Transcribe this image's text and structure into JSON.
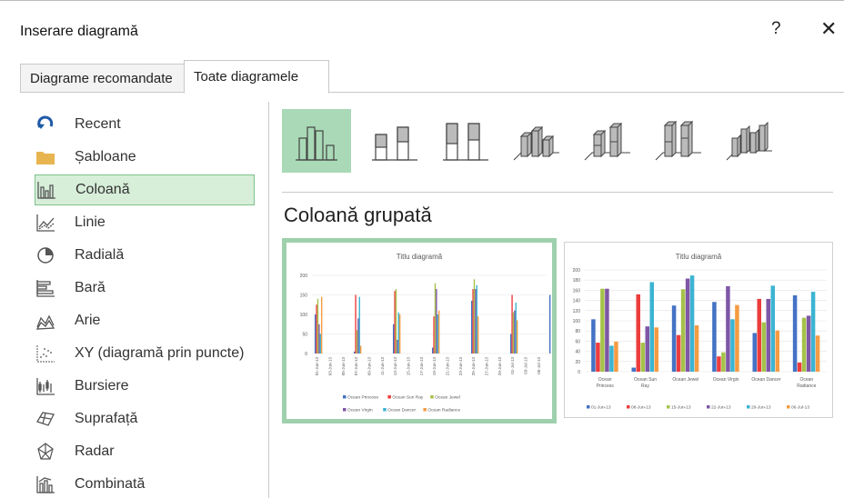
{
  "dialog": {
    "title": "Inserare diagramă",
    "help": "?",
    "close": "✕"
  },
  "tabs": [
    {
      "label": "Diagrame recomandate"
    },
    {
      "label": "Toate diagramele"
    }
  ],
  "categories": [
    {
      "label": "Recent",
      "icon": "recent-icon"
    },
    {
      "label": "Șabloane",
      "icon": "folder-icon"
    },
    {
      "label": "Coloană",
      "icon": "column-chart-icon",
      "selected": true
    },
    {
      "label": "Linie",
      "icon": "line-chart-icon"
    },
    {
      "label": "Radială",
      "icon": "pie-chart-icon"
    },
    {
      "label": "Bară",
      "icon": "bar-chart-icon"
    },
    {
      "label": "Arie",
      "icon": "area-chart-icon"
    },
    {
      "label": "XY (diagramă prin puncte)",
      "icon": "scatter-chart-icon"
    },
    {
      "label": "Bursiere",
      "icon": "stock-chart-icon"
    },
    {
      "label": "Suprafață",
      "icon": "surface-chart-icon"
    },
    {
      "label": "Radar",
      "icon": "radar-chart-icon"
    },
    {
      "label": "Combinată",
      "icon": "combo-chart-icon"
    }
  ],
  "subtype_heading": "Coloană grupată",
  "accent_color": "#a9d9b6",
  "chart_data": [
    {
      "type": "bar",
      "title": "Titlu diagramă",
      "ylim": [
        0,
        200
      ],
      "yticks": [
        0,
        50,
        100,
        150,
        200
      ],
      "x": [
        "01-Jun-13",
        "03-Jun-13",
        "05-Jun-13",
        "07-Jun-13",
        "09-Jun-13",
        "11-Jun-13",
        "13-Jun-13",
        "15-Jun-13",
        "17-Jun-13",
        "19-Jun-13",
        "21-Jun-13",
        "23-Jun-13",
        "25-Jun-13",
        "27-Jun-13",
        "29-Jun-13",
        "01-Jul-13",
        "03-Jul-13",
        "05-Jul-13"
      ],
      "series": [
        {
          "name": "Ocean Princess",
          "color": "#4472c4",
          "points": [
            [
              0,
              100
            ],
            [
              3,
              5
            ],
            [
              6,
              75
            ],
            [
              9,
              15
            ],
            [
              12,
              135
            ],
            [
              15,
              50
            ],
            [
              18,
              150
            ]
          ]
        },
        {
          "name": "Ocean Sun Ray",
          "color": "#ed3c3c",
          "points": [
            [
              0,
              125
            ],
            [
              3,
              150
            ],
            [
              6,
              160
            ],
            [
              9,
              95
            ],
            [
              12,
              165
            ],
            [
              15,
              150
            ]
          ]
        },
        {
          "name": "Ocean Jewel",
          "color": "#a5c249",
          "points": [
            [
              0,
              140
            ],
            [
              3,
              60
            ],
            [
              6,
              165
            ],
            [
              9,
              180
            ],
            [
              12,
              190
            ],
            [
              15,
              105
            ]
          ]
        },
        {
          "name": "Ocean Virgin",
          "color": "#7e57a6",
          "points": [
            [
              0,
              75
            ],
            [
              3,
              90
            ],
            [
              6,
              35
            ],
            [
              9,
              165
            ],
            [
              12,
              165
            ],
            [
              15,
              110
            ]
          ]
        },
        {
          "name": "Ocean Dancer",
          "color": "#3cb4d2",
          "points": [
            [
              0,
              50
            ],
            [
              3,
              145
            ],
            [
              6,
              105
            ],
            [
              9,
              100
            ],
            [
              12,
              175
            ],
            [
              15,
              130
            ]
          ]
        },
        {
          "name": "Ocean Radiance",
          "color": "#f59b43",
          "points": [
            [
              0,
              145
            ],
            [
              3,
              20
            ],
            [
              6,
              100
            ],
            [
              9,
              110
            ],
            [
              12,
              95
            ],
            [
              15,
              85
            ]
          ]
        }
      ]
    },
    {
      "type": "bar",
      "title": "Titlu diagramă",
      "ylim": [
        0,
        200
      ],
      "yticks": [
        0,
        20,
        40,
        60,
        80,
        100,
        120,
        140,
        160,
        180,
        200
      ],
      "categories": [
        "Ocean Princess",
        "Ocean Sun Ray",
        "Ocean Jewel",
        "Ocean Virgin",
        "Ocean Dancer",
        "Ocean Radiance"
      ],
      "series": [
        {
          "name": "01-Jun-13",
          "color": "#4472c4",
          "values": [
            103,
            8,
            130,
            137,
            76,
            150
          ]
        },
        {
          "name": "08-Jun-13",
          "color": "#ed3c3c",
          "values": [
            57,
            152,
            72,
            30,
            143,
            18
          ]
        },
        {
          "name": "15-Jun-13",
          "color": "#a5c249",
          "values": [
            163,
            57,
            162,
            38,
            97,
            106
          ]
        },
        {
          "name": "22-Jun-13",
          "color": "#7e57a6",
          "values": [
            163,
            89,
            183,
            168,
            143,
            110
          ]
        },
        {
          "name": "29-Jun-13",
          "color": "#3cb4d2",
          "values": [
            51,
            176,
            189,
            103,
            169,
            157
          ]
        },
        {
          "name": "06-Jul-13",
          "color": "#f59b43",
          "values": [
            59,
            87,
            91,
            131,
            81,
            71
          ]
        }
      ]
    }
  ]
}
